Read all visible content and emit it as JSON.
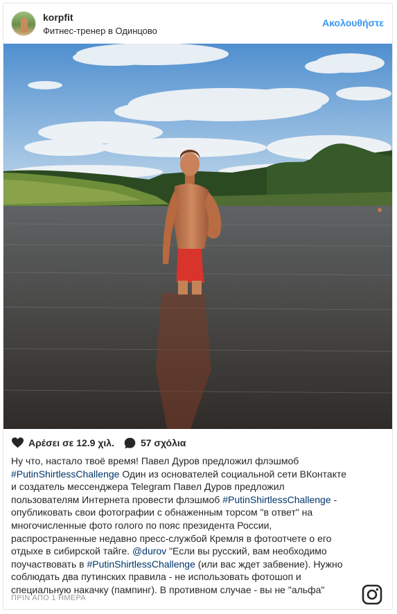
{
  "post": {
    "username": "korpfit",
    "location": "Фитнес-тренер в Одинцово",
    "follow_label": "Ακολουθήστε"
  },
  "actions": {
    "likes_label": "Αρέσει σε 12.9 χιλ.",
    "comments_label": "57 σχόλια"
  },
  "caption": {
    "p1": "Ну что, настало твоё время! Павел Дуров предложил флэшмоб ",
    "tag1": "#PutinShirtlessChallenge",
    "p2": " Один из основателей социальной сети ВКонтакте и создатель мессенджера Telegram Павел Дуров предложил пользователям Интернета провести флэшмоб ",
    "tag2": "#PutinShirtlessChallenge",
    "p3": " - опубликовать свои фотографии с обнаженным торсом \"в ответ\" на многочисленные фото голого по пояс президента России, распространенные недавно пресс-службой Кремля в фотоотчете о его отдыхе в сибирской тайге. ",
    "mention": "@durov",
    "p4": " \"Если вы русский, вам необходимо поучаствовать в ",
    "tag3": "#PutinShirtlessChallenge",
    "p5": " (или вас ждет забвение). Нужно соблюдать два путинских правила - не использовать фотошоп и специальную накачку (пампинг). В противном случае - вы не \"альфа\""
  },
  "timestamp": "ΠΡΙΝ ΑΠΟ 1 ΗΜΕΡΑ",
  "icons": {
    "like": "heart-icon",
    "comment": "comment-bubble-icon",
    "brand": "instagram-icon"
  },
  "colors": {
    "link": "#3897f0",
    "hashtag": "#003569",
    "text": "#262626",
    "muted": "#999999"
  }
}
